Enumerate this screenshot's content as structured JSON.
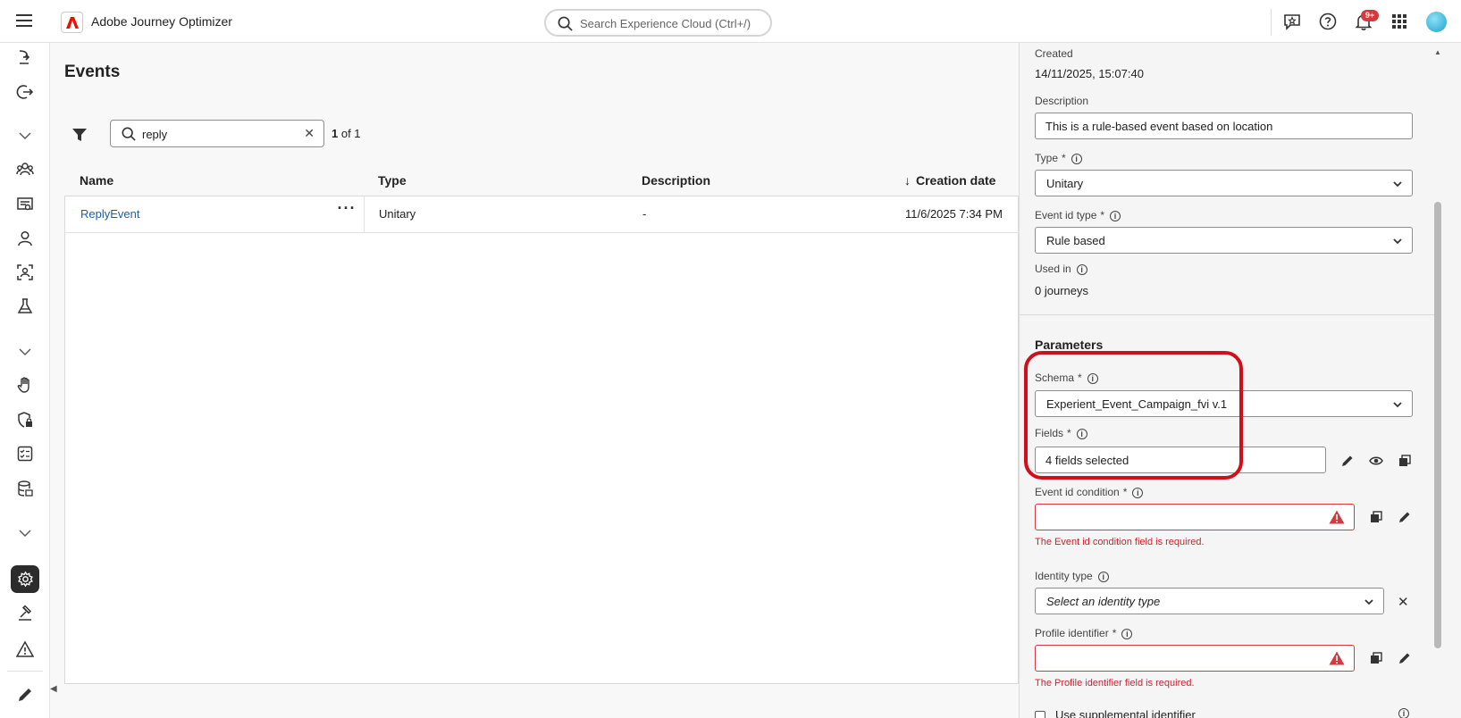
{
  "topbar": {
    "app_name": "Adobe Journey Optimizer",
    "search_placeholder": "Search Experience Cloud (Ctrl+/)",
    "notification_count": "9+"
  },
  "rail": {
    "icons": [
      "journey-icon",
      "logout-icon",
      "chevron-down-icon",
      "audiences-icon",
      "content-icon",
      "profile-icon",
      "identity-icon",
      "experiment-icon",
      "chevron-down-icon",
      "hand-icon",
      "shield-lock-icon",
      "checklist-icon",
      "data-icon",
      "chevron-down-icon",
      "settings-icon",
      "admin-icon",
      "alert-icon",
      "edit-icon"
    ]
  },
  "main": {
    "title": "Events",
    "search_value": "reply",
    "result_count_bold": "1",
    "result_count_rest": " of 1",
    "columns": {
      "name": "Name",
      "type": "Type",
      "description": "Description",
      "creation_date": "Creation date"
    },
    "rows": [
      {
        "name": "ReplyEvent",
        "type": "Unitary",
        "description": "-",
        "creation_date": "11/6/2025 7:34 PM"
      }
    ]
  },
  "panel": {
    "created_label": "Created",
    "created_value": "14/11/2025, 15:07:40",
    "description_label": "Description",
    "description_value": "This is a rule-based event based on location",
    "type_label": "Type",
    "type_value": "Unitary",
    "event_id_type_label": "Event id type",
    "event_id_type_value": "Rule based",
    "used_in_label": "Used in",
    "used_in_value": "0 journeys",
    "parameters_title": "Parameters",
    "schema_label": "Schema",
    "schema_value": "Experient_Event_Campaign_fvi v.1",
    "fields_label": "Fields",
    "fields_value": "4 fields selected",
    "event_id_condition_label": "Event id condition",
    "event_id_condition_error": "The Event id condition field is required.",
    "identity_type_label": "Identity type",
    "identity_type_placeholder": "Select an identity type",
    "profile_identifier_label": "Profile identifier",
    "profile_identifier_error": "The Profile identifier field is required.",
    "supplemental_label": "Use supplemental identifier",
    "required_mark": "*",
    "info_mark": "i"
  },
  "colors": {
    "accent_red": "#d00f1a",
    "link_blue": "#1a5fb4",
    "error_red": "#c9252d"
  }
}
